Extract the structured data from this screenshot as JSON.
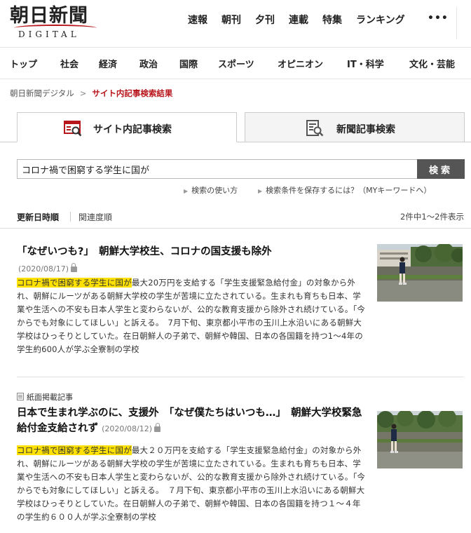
{
  "header": {
    "logo_main": "朝日新聞",
    "logo_sub": "DIGITAL",
    "top_nav": [
      "速報",
      "朝刊",
      "夕刊",
      "連載",
      "特集",
      "ランキング"
    ],
    "more": "•••"
  },
  "category_nav": [
    "トップ",
    "社会",
    "経済",
    "政治",
    "国際",
    "スポーツ",
    "オピニオン",
    "IT・科学",
    "文化・芸能"
  ],
  "breadcrumb": {
    "home": "朝日新聞デジタル",
    "separator": ">",
    "current": "サイト内記事検索結果"
  },
  "tabs": [
    {
      "label": "サイト内記事検索",
      "icon": "site-search-icon",
      "active": true
    },
    {
      "label": "新聞記事検索",
      "icon": "newspaper-search-icon",
      "active": false
    }
  ],
  "search": {
    "value": "コロナ禍で困窮する学生に国が",
    "button": "検索",
    "links": [
      "検索の使い方",
      "検索条件を保存するには？（MYキーワードへ）"
    ]
  },
  "sort": {
    "options": [
      "更新日時順",
      "関連度順"
    ],
    "active": "更新日時順",
    "count_text": "2件中1～2件表示"
  },
  "articles": [
    {
      "title": "「なぜいつも?」　朝鮮大学校生、コロナの国支援も除外",
      "date": "(2020/08/17)",
      "locked": true,
      "snippet_highlight": "コロナ禍で困窮する学生に国が",
      "snippet_rest": "最大20万円を支給する「学生支援緊急給付金」の対象から外れ、朝鮮にルーツがある朝鮮大学校の学生が苦境に立たされている。生まれも育ちも日本、学業や生活への不安も日本人学生と変わらないが、公的な教育支援から除外され続けている。「今からでも対象にしてほしい」と訴える。　7月下旬、東京都小平市の玉川上水沿いにある朝鮮大学校はひっそりとしていた。在日朝鮮人の子弟で、朝鮮や韓国、日本の各国籍を持つ1～4年の学生約600人が学ぶ全寮制の学校"
    },
    {
      "tag": "紙面掲載記事",
      "title": "日本で生まれ学ぶのに、支援外　「なぜ僕たちはいつも…」　朝鮮大学校緊急給付金支給されず",
      "date": "(2020/08/12)",
      "locked": true,
      "snippet_highlight": "コロナ禍で困窮する学生に国が",
      "snippet_rest": "最大２０万円を支給する「学生支援緊急給付金」の対象から外れ、朝鮮にルーツがある朝鮮大学校の学生が苦境に立たされている。生まれも育ちも日本、学業や生活への不安も日本人学生と変わらないが、公的な教育支援から除外され続けている。「今からでも対象にしてほしい」と訴える。　７月下旬、東京都小平市の玉川上水沿いにある朝鮮大学校はひっそりとしていた。在日朝鮮人の子弟で、朝鮮や韓国、日本の各国籍を持つ１～４年の学生約６００人が学ぶ全寮制の学校"
    }
  ],
  "colors": {
    "brand_red": "#b8161d",
    "highlight": "#ffe100",
    "search_button": "#555555"
  }
}
